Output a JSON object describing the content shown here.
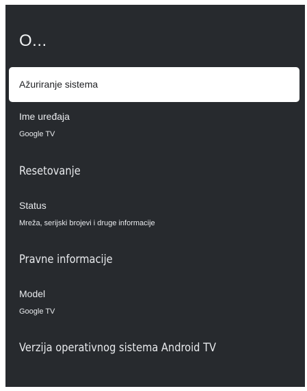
{
  "header": {
    "title": "O..."
  },
  "menu": {
    "items": [
      {
        "label": "Ažuriranje sistema",
        "focused": true
      },
      {
        "label": "Ime uređaja",
        "sublabel": "Google TV"
      },
      {
        "label": "Resetovanje"
      },
      {
        "label": "Status",
        "sublabel": "Mreža, serijski brojevi i druge informacije"
      },
      {
        "label": "Pravne informacije"
      },
      {
        "label": "Model",
        "sublabel": "Google TV"
      },
      {
        "label": "Verzija operativnog sistema Android TV"
      }
    ]
  },
  "colors": {
    "panel_background": "#272a2e",
    "focused_background": "#ffffff",
    "text": "#e8eaed",
    "focused_text": "#202124"
  }
}
